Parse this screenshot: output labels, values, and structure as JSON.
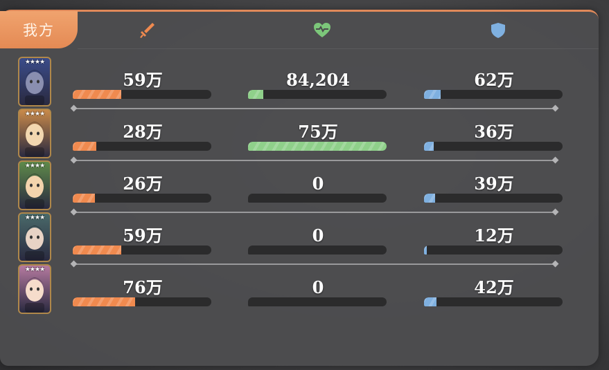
{
  "header": {
    "tab_label": "我方",
    "columns": [
      {
        "name": "attack",
        "icon": "sword-icon",
        "color": "#f08a4f"
      },
      {
        "name": "heal",
        "icon": "heart-icon",
        "color": "#7cc77a"
      },
      {
        "name": "defense",
        "icon": "shield-icon",
        "color": "#7fb0e0"
      }
    ]
  },
  "colors": {
    "attack": "#f08a4f",
    "heal": "#8fd08a",
    "defense": "#7fb0e0",
    "accent": "#e48a54"
  },
  "heroes": [
    {
      "stars": "★★★★",
      "avatar_bg": "#3b4c8a",
      "face": "#8a8fb0",
      "attack": {
        "label": "59万",
        "fraction": 0.35
      },
      "heal": {
        "label": "84,204",
        "fraction": 0.11
      },
      "defense": {
        "label": "62万",
        "fraction": 0.12
      }
    },
    {
      "stars": "★★★★",
      "avatar_bg": "#c98a4a",
      "face": "#f2d7b0",
      "attack": {
        "label": "28万",
        "fraction": 0.17
      },
      "heal": {
        "label": "75万",
        "fraction": 1.0
      },
      "defense": {
        "label": "36万",
        "fraction": 0.07
      }
    },
    {
      "stars": "★★★★",
      "avatar_bg": "#5f8a4a",
      "face": "#f3d4ad",
      "attack": {
        "label": "26万",
        "fraction": 0.16
      },
      "heal": {
        "label": "0",
        "fraction": 0
      },
      "defense": {
        "label": "39万",
        "fraction": 0.08
      }
    },
    {
      "stars": "★★★★",
      "avatar_bg": "#4a6a6a",
      "face": "#e8d3c5",
      "attack": {
        "label": "59万",
        "fraction": 0.35
      },
      "heal": {
        "label": "0",
        "fraction": 0
      },
      "defense": {
        "label": "12万",
        "fraction": 0.02
      }
    },
    {
      "stars": "★★★★",
      "avatar_bg": "#b57aa0",
      "face": "#f6dccb",
      "attack": {
        "label": "76万",
        "fraction": 0.45
      },
      "heal": {
        "label": "0",
        "fraction": 0
      },
      "defense": {
        "label": "42万",
        "fraction": 0.09
      }
    }
  ]
}
